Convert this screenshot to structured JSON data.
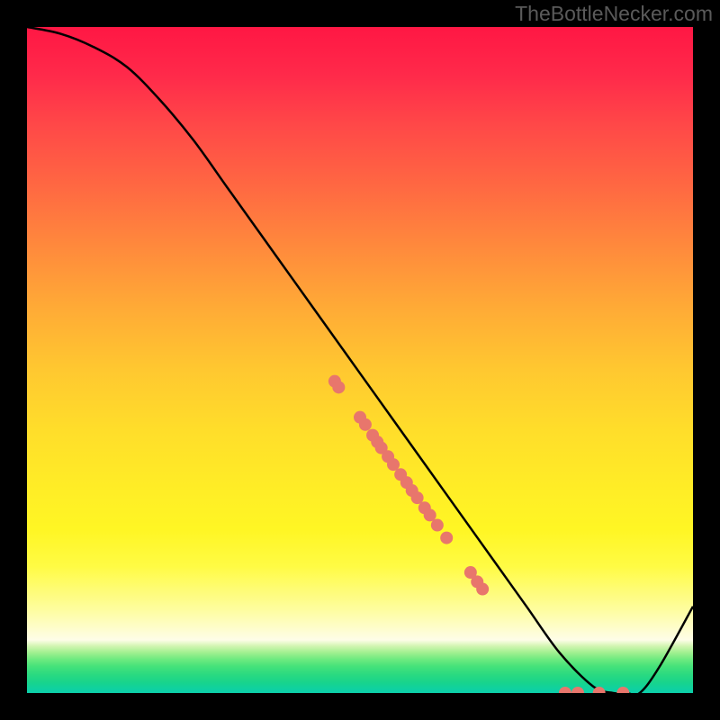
{
  "watermark": "TheBottleNecker.com",
  "chart_data": {
    "type": "line",
    "title": "",
    "xlabel": "",
    "ylabel": "",
    "xlim": [
      0,
      100
    ],
    "ylim": [
      0,
      100
    ],
    "series": [
      {
        "name": "curve",
        "x": [
          0,
          5,
          10,
          15,
          20,
          25,
          30,
          35,
          40,
          45,
          50,
          55,
          60,
          65,
          70,
          75,
          80,
          85,
          88,
          90,
          92,
          95,
          100
        ],
        "y": [
          100,
          99,
          97,
          94,
          89,
          83,
          76,
          69,
          62,
          55,
          48,
          41,
          34,
          27,
          20,
          13,
          6,
          1,
          0,
          0,
          0,
          4,
          13
        ]
      }
    ],
    "scatter": {
      "name": "dots",
      "points": [
        {
          "x": 46.2,
          "y": 46.8
        },
        {
          "x": 46.8,
          "y": 45.9
        },
        {
          "x": 50.0,
          "y": 41.4
        },
        {
          "x": 50.8,
          "y": 40.3
        },
        {
          "x": 51.9,
          "y": 38.7
        },
        {
          "x": 52.6,
          "y": 37.7
        },
        {
          "x": 53.2,
          "y": 36.8
        },
        {
          "x": 54.2,
          "y": 35.5
        },
        {
          "x": 55.0,
          "y": 34.3
        },
        {
          "x": 56.1,
          "y": 32.8
        },
        {
          "x": 57.0,
          "y": 31.6
        },
        {
          "x": 57.8,
          "y": 30.4
        },
        {
          "x": 58.6,
          "y": 29.3
        },
        {
          "x": 59.7,
          "y": 27.8
        },
        {
          "x": 60.5,
          "y": 26.7
        },
        {
          "x": 61.6,
          "y": 25.2
        },
        {
          "x": 63.0,
          "y": 23.3
        },
        {
          "x": 66.6,
          "y": 18.1
        },
        {
          "x": 67.6,
          "y": 16.7
        },
        {
          "x": 68.4,
          "y": 15.6
        },
        {
          "x": 80.8,
          "y": 0.0
        },
        {
          "x": 82.7,
          "y": 0.0
        },
        {
          "x": 85.9,
          "y": 0.0
        },
        {
          "x": 89.5,
          "y": 0.0
        }
      ]
    }
  }
}
